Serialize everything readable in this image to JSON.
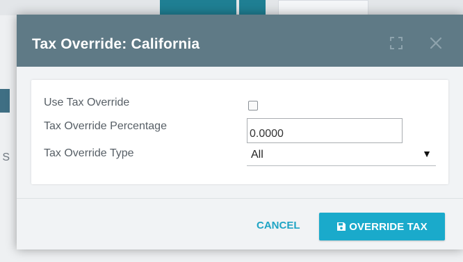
{
  "modal": {
    "title": "Tax Override: California",
    "expand_icon": "expand-icon",
    "close_icon": "close-icon"
  },
  "form": {
    "use_override_label": "Use Tax Override",
    "use_override_checked": false,
    "percentage_label": "Tax Override Percentage",
    "percentage_value": "0.0000",
    "type_label": "Tax Override Type",
    "type_selected": "All"
  },
  "footer": {
    "cancel_label": "CANCEL",
    "override_label": "OVERRIDE TAX",
    "override_icon": "save-icon"
  },
  "background": {
    "partial_letter": "S"
  },
  "colors": {
    "header": "#5f7a86",
    "accent": "#1aaacb",
    "cancel_text": "#1fa4c4"
  }
}
